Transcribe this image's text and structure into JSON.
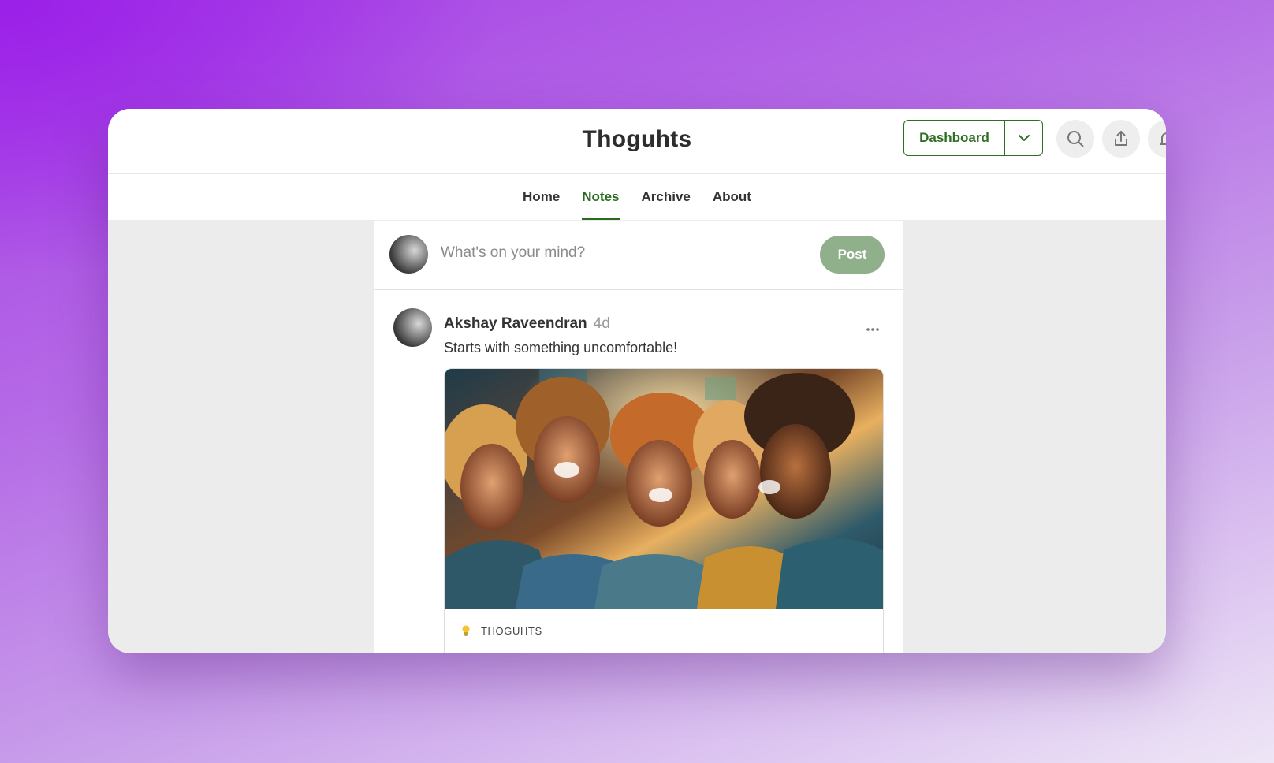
{
  "header": {
    "site_title": "Thoguhts",
    "dashboard_label": "Dashboard"
  },
  "nav": {
    "items": [
      {
        "label": "Home",
        "active": false
      },
      {
        "label": "Notes",
        "active": true
      },
      {
        "label": "Archive",
        "active": false
      },
      {
        "label": "About",
        "active": false
      }
    ]
  },
  "composer": {
    "placeholder": "What's on your mind?",
    "post_label": "Post"
  },
  "note": {
    "author": "Akshay Raveendran",
    "time": "4d",
    "text": "Starts with something uncomfortable!",
    "card_label": "THOGUHTS"
  },
  "icons": {
    "dashboard_caret": "chevron-down-icon",
    "search": "search-icon",
    "share": "share-icon",
    "notifications": "bell-icon",
    "more": "more-icon",
    "card": "lightbulb-icon"
  },
  "colors": {
    "accent_green": "#2f6f23",
    "post_button": "#8fb08a"
  }
}
